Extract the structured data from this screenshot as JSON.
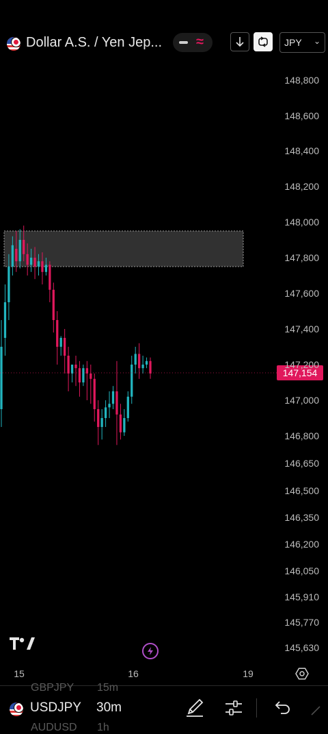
{
  "header": {
    "title": "Dollar A.S. / Yen Jep...",
    "currency": "JPY",
    "mode_icon": "wave-icon",
    "colors": {
      "wave": "#e0185c"
    }
  },
  "chart_data": {
    "type": "candlestick",
    "symbol": "USDJPY",
    "timeframe": "30m",
    "current_price": "147,154",
    "y_ticks": [
      "148,800",
      "148,600",
      "148,400",
      "148,200",
      "148,000",
      "147,800",
      "147,600",
      "147,400",
      "147,200",
      "147,000",
      "146,800",
      "146,650",
      "146,500",
      "146,350",
      "146,200",
      "146,050",
      "145,910",
      "145,770",
      "145,630"
    ],
    "x_ticks": [
      "15",
      "16",
      "19"
    ],
    "zone": {
      "price_high": 147.95,
      "price_low": 147.75
    },
    "colors": {
      "up": "#22b5bf",
      "down": "#e0185c",
      "price_label_bg": "#e0185c",
      "zone_fill": "#3a3a3a"
    },
    "candles": [
      [
        146.95,
        147.45,
        147.3,
        146.85
      ],
      [
        147.35,
        147.65,
        147.55,
        147.25
      ],
      [
        147.55,
        147.82,
        147.75,
        147.45
      ],
      [
        147.75,
        147.92,
        147.87,
        147.7
      ],
      [
        147.85,
        147.95,
        147.78,
        147.72
      ],
      [
        147.78,
        147.96,
        147.9,
        147.74
      ],
      [
        147.9,
        147.98,
        147.82,
        147.78
      ],
      [
        147.82,
        147.88,
        147.76,
        147.7
      ],
      [
        147.76,
        147.85,
        147.8,
        147.72
      ],
      [
        147.8,
        147.86,
        147.75,
        147.68
      ],
      [
        147.75,
        147.82,
        147.78,
        147.7
      ],
      [
        147.78,
        147.83,
        147.72,
        147.65
      ],
      [
        147.72,
        147.8,
        147.76,
        147.7
      ],
      [
        147.76,
        147.78,
        147.62,
        147.55
      ],
      [
        147.62,
        147.66,
        147.45,
        147.38
      ],
      [
        147.45,
        147.5,
        147.3,
        147.2
      ],
      [
        147.3,
        147.36,
        147.35,
        147.25
      ],
      [
        147.35,
        147.4,
        147.25,
        147.15
      ],
      [
        147.25,
        147.3,
        147.15,
        147.05
      ],
      [
        147.15,
        147.2,
        147.2,
        147.1
      ],
      [
        147.2,
        147.25,
        147.18,
        147.08
      ],
      [
        147.18,
        147.22,
        147.1,
        147.02
      ],
      [
        147.1,
        147.2,
        147.18,
        147.08
      ],
      [
        147.18,
        147.22,
        147.15,
        147.0
      ],
      [
        147.15,
        147.2,
        147.12,
        146.98
      ],
      [
        147.12,
        147.15,
        146.95,
        146.88
      ],
      [
        146.95,
        147.0,
        146.85,
        146.75
      ],
      [
        146.85,
        146.95,
        146.9,
        146.78
      ],
      [
        146.9,
        147.0,
        146.96,
        146.85
      ],
      [
        146.96,
        147.05,
        146.98,
        146.9
      ],
      [
        146.98,
        147.08,
        147.05,
        146.95
      ],
      [
        147.05,
        147.22,
        146.92,
        146.75
      ],
      [
        146.92,
        146.98,
        146.82,
        146.78
      ],
      [
        146.82,
        146.95,
        146.9,
        146.8
      ],
      [
        146.9,
        147.05,
        147.02,
        146.88
      ],
      [
        147.02,
        147.25,
        147.2,
        146.98
      ],
      [
        147.2,
        147.3,
        147.26,
        147.15
      ],
      [
        147.26,
        147.32,
        147.18,
        147.12
      ],
      [
        147.18,
        147.25,
        147.2,
        147.15
      ],
      [
        147.2,
        147.24,
        147.22,
        147.18
      ],
      [
        147.22,
        147.24,
        147.15,
        147.12
      ]
    ]
  },
  "bottom_bar": {
    "symbol": "USDJPY",
    "timeframe": "30m",
    "ghost_prev_symbol": "GBPJPY",
    "ghost_prev_timeframe": "15m",
    "ghost_next_symbol": "AUDUSD",
    "ghost_next_timeframe": "1h",
    "icons": [
      "brush-icon",
      "sliders-icon",
      "undo-icon"
    ]
  }
}
